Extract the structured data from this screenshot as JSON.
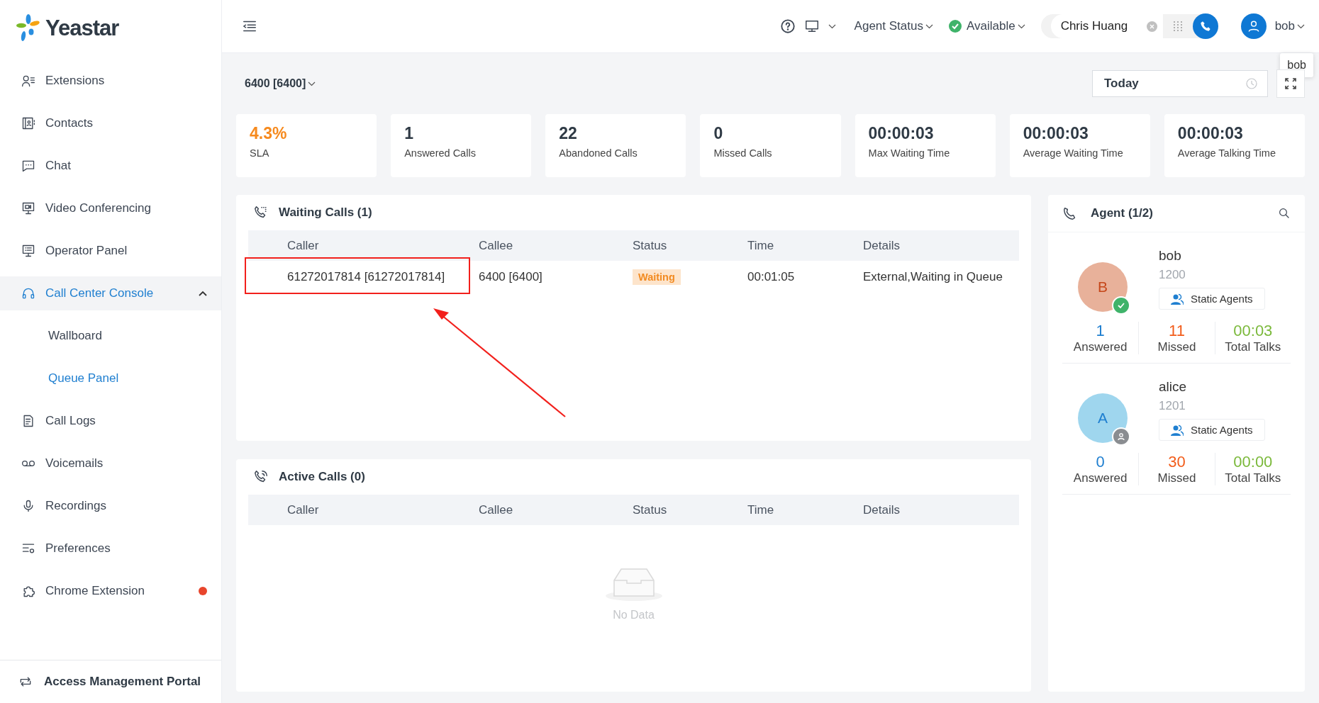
{
  "brand": "Yeastar",
  "sidebar": {
    "items": [
      {
        "label": "Extensions",
        "selected": false
      },
      {
        "label": "Contacts",
        "selected": false
      },
      {
        "label": "Chat",
        "selected": false
      },
      {
        "label": "Video Conferencing",
        "selected": false
      },
      {
        "label": "Operator Panel",
        "selected": false
      },
      {
        "label": "Call Center Console",
        "selected": true,
        "expanded": true,
        "children": [
          {
            "label": "Wallboard",
            "selected": false
          },
          {
            "label": "Queue Panel",
            "selected": true
          }
        ]
      },
      {
        "label": "Call Logs",
        "selected": false
      },
      {
        "label": "Voicemails",
        "selected": false
      },
      {
        "label": "Recordings",
        "selected": false
      },
      {
        "label": "Preferences",
        "selected": false
      },
      {
        "label": "Chrome Extension",
        "selected": false,
        "notification": true
      }
    ],
    "footer": "Access Management Portal"
  },
  "topbar": {
    "agent_status_label": "Agent Status",
    "status": "Available",
    "dial_value": "Chris Huang",
    "user": "bob",
    "tooltip": "bob"
  },
  "queue": "6400 [6400]",
  "date_range": "Today",
  "stats": [
    {
      "value": "4.3%",
      "label": "SLA",
      "kind": "percent"
    },
    {
      "value": "1",
      "label": "Answered Calls",
      "kind": "count"
    },
    {
      "value": "22",
      "label": "Abandoned Calls",
      "kind": "count"
    },
    {
      "value": "0",
      "label": "Missed Calls",
      "kind": "count"
    },
    {
      "value": "00:00:03",
      "label": "Max Waiting Time",
      "kind": "time"
    },
    {
      "value": "00:00:03",
      "label": "Average Waiting Time",
      "kind": "time"
    },
    {
      "value": "00:00:03",
      "label": "Average Talking Time",
      "kind": "time"
    }
  ],
  "waiting_calls": {
    "title": "Waiting Calls (1)",
    "columns": [
      "Caller",
      "Callee",
      "Status",
      "Time",
      "Details"
    ],
    "rows": [
      {
        "caller": "61272017814 [61272017814]",
        "callee": "6400 [6400]",
        "status": "Waiting",
        "time": "00:01:05",
        "details": "External,Waiting in Queue"
      }
    ]
  },
  "active_calls": {
    "title": "Active Calls (0)",
    "columns": [
      "Caller",
      "Callee",
      "Status",
      "Time",
      "Details"
    ],
    "empty_text": "No Data"
  },
  "agents": {
    "title": "Agent (1/2)",
    "items": [
      {
        "name": "bob",
        "extension": "1200",
        "initial": "B",
        "color": "#e8b19a",
        "available": true,
        "group": "Static Agents",
        "stats": [
          {
            "value": "1",
            "label": "Answered",
            "kind": "answered"
          },
          {
            "value": "11",
            "label": "Missed",
            "kind": "missed"
          },
          {
            "value": "00:03",
            "label": "Total Talks",
            "kind": "talk"
          }
        ]
      },
      {
        "name": "alice",
        "extension": "1201",
        "initial": "A",
        "color": "#9fd6ee",
        "available": false,
        "group": "Static Agents",
        "stats": [
          {
            "value": "0",
            "label": "Answered",
            "kind": "answered"
          },
          {
            "value": "30",
            "label": "Missed",
            "kind": "missed"
          },
          {
            "value": "00:00",
            "label": "Total Talks",
            "kind": "talk"
          }
        ]
      }
    ]
  }
}
